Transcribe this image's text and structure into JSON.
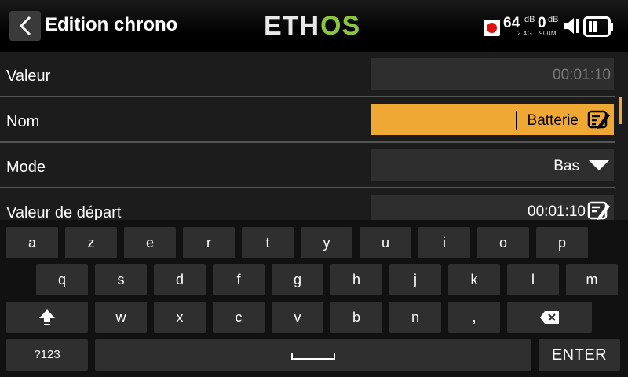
{
  "header": {
    "title": "Edition chrono",
    "logo_text": "ETHOS",
    "status": {
      "rssi_value": "64",
      "rssi_unit": "dB",
      "rssi_band": "2.4G",
      "rssi2_value": "0",
      "rssi2_unit": "dB",
      "rssi2_band": "900M"
    }
  },
  "form": {
    "rows": [
      {
        "label": "Valeur",
        "value": "00:01:10"
      },
      {
        "label": "Nom",
        "value": "Batterie"
      },
      {
        "label": "Mode",
        "value": "Bas"
      },
      {
        "label": "Valeur de départ",
        "value": "00:01:10"
      }
    ]
  },
  "keyboard": {
    "row1": [
      "a",
      "z",
      "e",
      "r",
      "t",
      "y",
      "u",
      "i",
      "o",
      "p"
    ],
    "row2": [
      "q",
      "s",
      "d",
      "f",
      "g",
      "h",
      "j",
      "k",
      "l",
      "m"
    ],
    "row3": [
      "w",
      "x",
      "c",
      "v",
      "b",
      "n",
      ","
    ],
    "numbers_label": "?123",
    "enter_label": "ENTER"
  },
  "colors": {
    "accent": "#efa834",
    "logo_green": "#8cc63f",
    "background": "#1c1c1c",
    "field": "#2e2e2e"
  }
}
